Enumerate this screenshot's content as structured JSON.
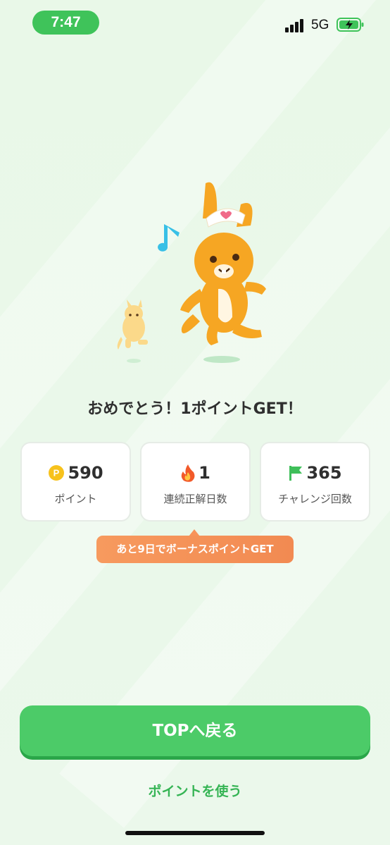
{
  "status_bar": {
    "time": "7:47",
    "network": "5G"
  },
  "result": {
    "headline": "おめでとう！1ポイントGET！"
  },
  "stats": [
    {
      "icon": "coin-icon",
      "value": "590",
      "label": "ポイント"
    },
    {
      "icon": "flame-icon",
      "value": "1",
      "label": "連続正解日数"
    },
    {
      "icon": "flag-icon",
      "value": "365",
      "label": "チャレンジ回数"
    }
  ],
  "bonus_tip": "あと9日でボーナスポイントGET",
  "actions": {
    "top_button": "TOPへ戻る",
    "use_points": "ポイントを使う"
  },
  "colors": {
    "primary": "#4ccb68",
    "accent": "#f28a52"
  }
}
